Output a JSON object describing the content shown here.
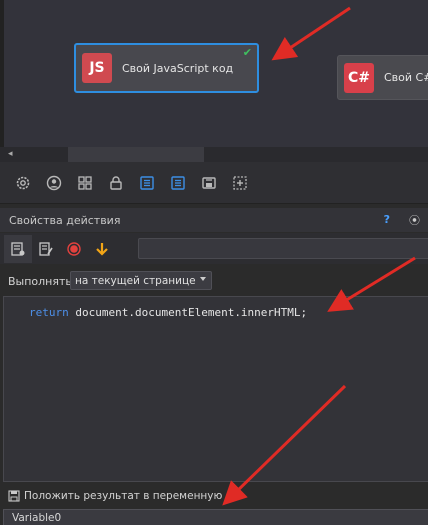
{
  "canvas": {
    "nodes": [
      {
        "badge": "JS",
        "label": "Свой JavaScript код",
        "check": "✔"
      },
      {
        "badge": "C#",
        "label": "Свой C#"
      }
    ],
    "scroll_left_icon": "◂"
  },
  "toolbar": {
    "icons": [
      "gear-icon",
      "user-circle-icon",
      "grid-icon",
      "lock-icon",
      "list-icon",
      "list-icon",
      "save-network-icon",
      "add-frame-icon"
    ]
  },
  "properties": {
    "title": "Свойства действия",
    "help": "?",
    "pin": "⦿",
    "execute_label": "Выполнять",
    "execute_value": "на текущей странице",
    "code_keyword": "return",
    "code_rest": " document.documentElement.innerHTML;",
    "save_label": "Положить результат в переменную",
    "variable_value": "Variable0"
  },
  "colors": {
    "accent_blue": "#2e8ee0",
    "js_badge": "#d04a50",
    "arrow_red": "#e02b25",
    "keyword_blue": "#4d8fe8"
  }
}
